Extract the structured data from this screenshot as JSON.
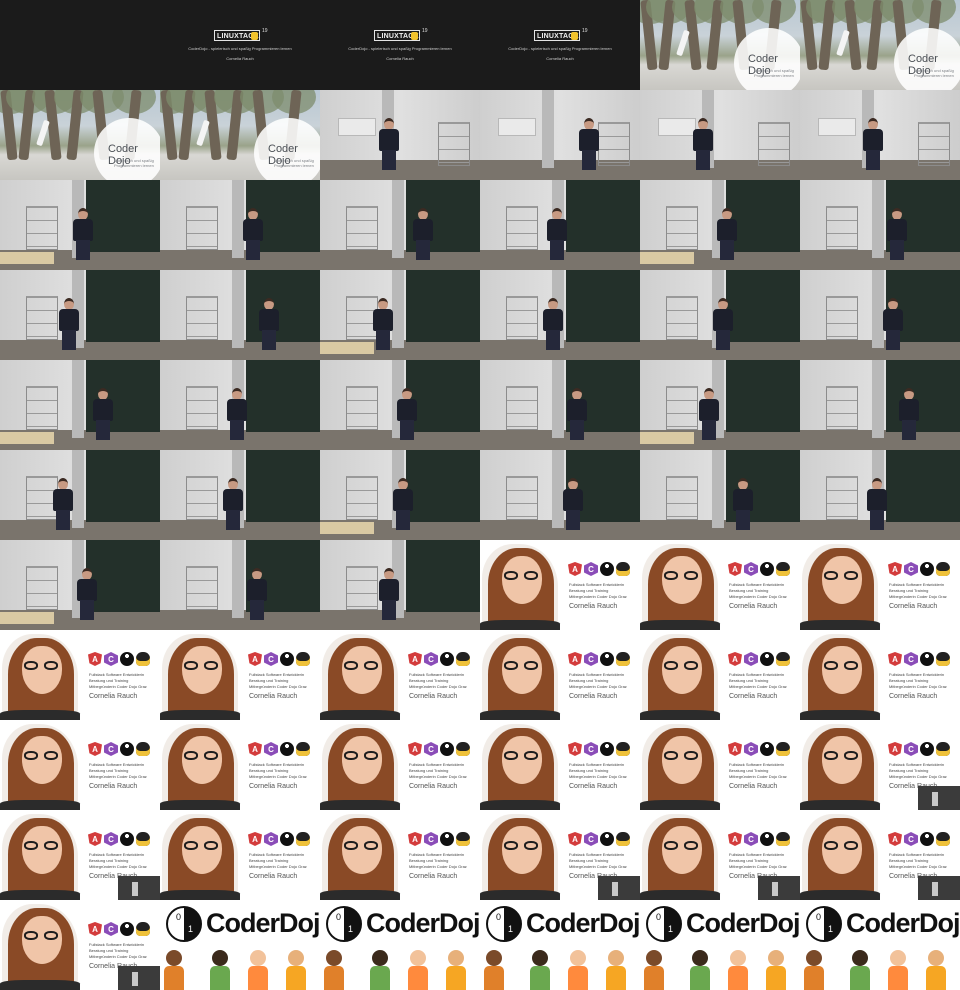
{
  "title_slide": {
    "logo_text": "LINUXTAGE",
    "logo_sup": "19",
    "subtitle": "CoderDojo - spielerisch und spaßig Programmieren lernen",
    "speaker": "Cornelia Rauch"
  },
  "park_slide": {
    "title": "Coder Dojo",
    "subtitle": "spielerisch und spaßig Programmieren lernen"
  },
  "profile_slide": {
    "lines": [
      "Fullstack Software Entwicklerin",
      "Beratung und Training",
      "Mitbegründerin Coder Dojo Graz"
    ],
    "name": "Cornelia Rauch",
    "icons": [
      "angular-icon",
      "csharp-icon",
      "yin-yang-icon",
      "tux-icon"
    ]
  },
  "dojo_slide": {
    "wordmark": "CoderDojo"
  },
  "tiles": [
    "blank",
    "title",
    "title",
    "title",
    "park",
    "park",
    "park",
    "park",
    "room_a",
    "room_a",
    "room_a",
    "room_a",
    "room_b",
    "room_b",
    "room_b",
    "room_b",
    "room_b",
    "room_b",
    "room_b",
    "room_b",
    "room_b",
    "room_b",
    "room_b",
    "room_b",
    "room_b",
    "room_b",
    "room_b",
    "room_b",
    "room_b",
    "room_b",
    "room_b",
    "room_b",
    "room_b",
    "room_b",
    "room_b",
    "room_b",
    "room_b",
    "room_b",
    "room_b",
    "profile",
    "profile",
    "profile",
    "profile",
    "profile",
    "profile",
    "profile",
    "profile",
    "profile",
    "profile",
    "profile",
    "profile",
    "profile",
    "profile",
    "profile_inset",
    "profile_inset",
    "profile",
    "profile",
    "profile_inset",
    "profile_inset",
    "profile_inset",
    "profile_inset",
    "dojo",
    "dojo",
    "dojo",
    "dojo",
    "dojo"
  ]
}
